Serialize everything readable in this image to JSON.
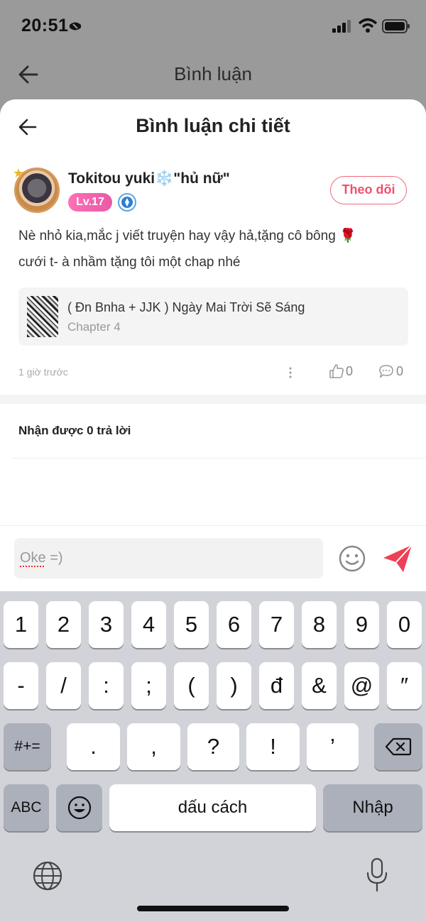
{
  "status_bar": {
    "time": "20:51"
  },
  "background_screen": {
    "title": "Bình luận"
  },
  "sheet": {
    "title": "Bình luận chi tiết"
  },
  "comment": {
    "user_name": "Tokitou yuki",
    "user_name_emoji": "❄️",
    "user_name_suffix": "\"hủ nữ\"",
    "level": "Lv.17",
    "follow_label": "Theo dõi",
    "text_line1": "Nè nhỏ kia,mắc j viết truyện hay vậy hả,tặng cô bông",
    "text_emoji": "🌹",
    "text_line2": "cưới t- à nhầm tặng tôi một chap nhé",
    "story_title": "( Đn Bnha + JJK ) Ngày Mai Trời Sẽ Sáng",
    "story_chapter": "Chapter 4",
    "time_ago": "1 giờ trước",
    "like_count": "0",
    "reply_count": "0"
  },
  "replies": {
    "heading": "Nhận được 0 trả lời"
  },
  "input": {
    "value_typo": "Oke",
    "value_rest": " =)"
  },
  "keyboard": {
    "row1": [
      "1",
      "2",
      "3",
      "4",
      "5",
      "6",
      "7",
      "8",
      "9",
      "0"
    ],
    "row2": [
      "-",
      "/",
      ":",
      ";",
      "(",
      ")",
      "đ",
      "&",
      "@",
      "″"
    ],
    "row3": [
      "#+=",
      ".",
      ",",
      "?",
      "!",
      "’"
    ],
    "row4": {
      "abc": "ABC",
      "space": "dấu cách",
      "enter": "Nhập"
    }
  },
  "colors": {
    "accent": "#f0506a",
    "level_badge": "#ff6fb3",
    "keyboard_bg": "#d1d3d9"
  }
}
